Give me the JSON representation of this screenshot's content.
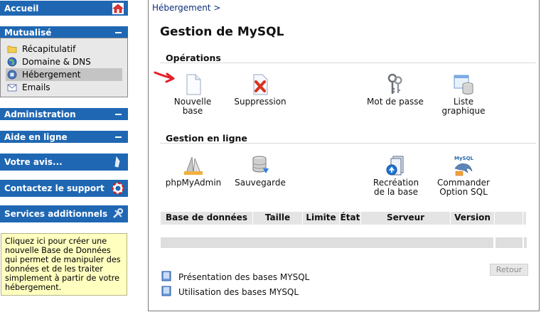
{
  "sidebar": {
    "accueil": "Accueil",
    "mutualise": "Mutualisé",
    "submenu": [
      {
        "label": "Récapitulatif",
        "icon": "folder-icon"
      },
      {
        "label": "Domaine & DNS",
        "icon": "globe-icon"
      },
      {
        "label": "Hébergement",
        "icon": "server-icon",
        "active": true
      },
      {
        "label": "Emails",
        "icon": "envelope-icon"
      }
    ],
    "administration": "Administration",
    "aide": "Aide en ligne",
    "avis": "Votre avis...",
    "support": "Contactez le support",
    "services": "Services additionnels",
    "help_text": "Cliquez ici pour créer une nouvelle Base de Données qui permet de manipuler des données et de les traiter simplement à partir de votre hébergement."
  },
  "main": {
    "breadcrumb": "Hébergement >",
    "title": "Gestion de MySQL",
    "operations": {
      "heading": "Opérations",
      "items": [
        {
          "label": "Nouvelle\nbase",
          "icon": "new-document-icon"
        },
        {
          "label": "Suppression",
          "icon": "delete-document-icon"
        },
        {
          "label": "Mot de passe",
          "icon": "keys-icon"
        },
        {
          "label": "Liste\ngraphique",
          "icon": "database-list-icon"
        }
      ]
    },
    "online": {
      "heading": "Gestion en ligne",
      "items": [
        {
          "label": "phpMyAdmin",
          "icon": "phpmyadmin-icon"
        },
        {
          "label": "Sauvegarde",
          "icon": "backup-icon"
        },
        {
          "label": "Recréation\nde la base",
          "icon": "recreate-icon"
        },
        {
          "label": "Commander\nOption SQL",
          "icon": "mysql-dolphin-icon"
        }
      ]
    },
    "table": {
      "columns": [
        "Base de données",
        "Taille",
        "Limite",
        "État",
        "Serveur",
        "Version"
      ]
    },
    "retour": "Retour",
    "links": [
      "Présentation des bases MYSQL",
      "Utilisation des bases MYSQL"
    ]
  },
  "colors": {
    "nav_blue": "#1f67b3",
    "help_yellow": "#ffffc0",
    "arrow_red": "#e3202a"
  }
}
